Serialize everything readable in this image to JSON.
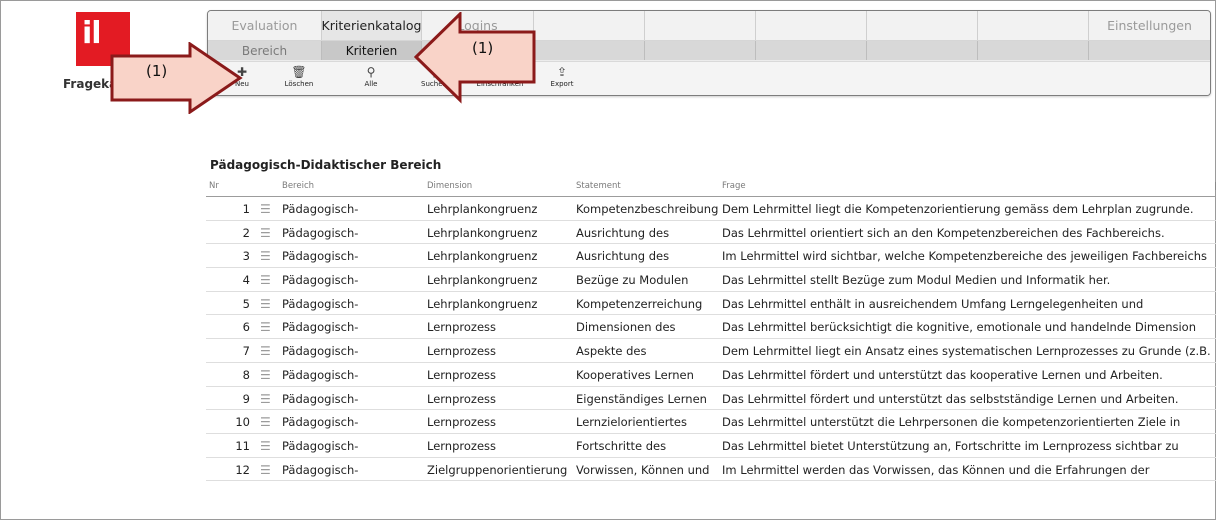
{
  "app": {
    "logo_text": "il",
    "name": "Fragekatalog"
  },
  "tabs_row1": [
    "Evaluation",
    "Kriterienkatalog",
    "Logins",
    "",
    "",
    "",
    "",
    "",
    "Einstellungen"
  ],
  "tabs_row2": [
    "Bereich",
    "Kriterien",
    "",
    "",
    "",
    "",
    "",
    "",
    ""
  ],
  "actions": [
    {
      "label": "Neu",
      "icon": "plus-icon",
      "glyph": "✚"
    },
    {
      "label": "Löschen",
      "icon": "trash-icon",
      "glyph": "🗑"
    },
    {
      "label": "Alle",
      "icon": "search-icon",
      "glyph": "⚲"
    },
    {
      "label": "Suchen",
      "icon": "search-icon",
      "glyph": "⚲"
    },
    {
      "label": "Einschränken",
      "icon": "search-icon",
      "glyph": "⚲"
    },
    {
      "label": "Export",
      "icon": "export-icon",
      "glyph": "⇪"
    }
  ],
  "callouts": {
    "left": "(1)",
    "right": "(1)",
    "arrow_fill": "#f9d3c8",
    "arrow_stroke": "#8b1a1a"
  },
  "section_title": "Pädagogisch-Didaktischer Bereich",
  "columns": {
    "nr": "Nr",
    "bereich": "Bereich",
    "dimension": "Dimension",
    "statement": "Statement",
    "frage": "Frage"
  },
  "rows": [
    {
      "nr": "1",
      "bereich": "Pädagogisch-",
      "dimension": "Lehrplankongruenz",
      "statement": "Kompetenzbeschreibung",
      "frage": "Dem Lehrmittel liegt die Kompetenzorientierung gemäss dem Lehrplan zugrunde."
    },
    {
      "nr": "2",
      "bereich": "Pädagogisch-",
      "dimension": "Lehrplankongruenz",
      "statement": "Ausrichtung des",
      "frage": "Das Lehrmittel orientiert sich an den Kompetenzbereichen des Fachbereichs."
    },
    {
      "nr": "3",
      "bereich": "Pädagogisch-",
      "dimension": "Lehrplankongruenz",
      "statement": "Ausrichtung des",
      "frage": "Im Lehrmittel wird sichtbar, welche Kompetenzbereiche des jeweiligen Fachbereichs"
    },
    {
      "nr": "4",
      "bereich": "Pädagogisch-",
      "dimension": "Lehrplankongruenz",
      "statement": "Bezüge zu Modulen",
      "frage": "Das Lehrmittel stellt Bezüge zum Modul Medien und Informatik her."
    },
    {
      "nr": "5",
      "bereich": "Pädagogisch-",
      "dimension": "Lehrplankongruenz",
      "statement": "Kompetenzerreichung",
      "frage": "Das Lehrmittel enthält in ausreichendem Umfang Lerngelegenheiten und"
    },
    {
      "nr": "6",
      "bereich": "Pädagogisch-",
      "dimension": "Lernprozess",
      "statement": "Dimensionen des",
      "frage": "Das Lehrmittel berücksichtigt die kognitive, emotionale und handelnde Dimension"
    },
    {
      "nr": "7",
      "bereich": "Pädagogisch-",
      "dimension": "Lernprozess",
      "statement": "Aspekte des",
      "frage": "Dem Lehrmittel liegt ein Ansatz eines systematischen Lernprozesses zu Grunde (z.B."
    },
    {
      "nr": "8",
      "bereich": "Pädagogisch-",
      "dimension": "Lernprozess",
      "statement": "Kooperatives Lernen",
      "frage": "Das Lehrmittel fördert und unterstützt das kooperative Lernen und Arbeiten."
    },
    {
      "nr": "9",
      "bereich": "Pädagogisch-",
      "dimension": "Lernprozess",
      "statement": "Eigenständiges Lernen",
      "frage": "Das Lehrmittel fördert und unterstützt das selbstständige Lernen und Arbeiten."
    },
    {
      "nr": "10",
      "bereich": "Pädagogisch-",
      "dimension": "Lernprozess",
      "statement": "Lernzielorientiertes",
      "frage": "Das Lehrmittel unterstützt die Lehrpersonen die kompetenzorientierten Ziele in"
    },
    {
      "nr": "11",
      "bereich": "Pädagogisch-",
      "dimension": "Lernprozess",
      "statement": "Fortschritte des",
      "frage": "Das Lehrmittel bietet Unterstützung an, Fortschritte im Lernprozess sichtbar zu"
    },
    {
      "nr": "12",
      "bereich": "Pädagogisch-",
      "dimension": "Zielgruppenorientierung",
      "statement": "Vorwissen, Können und",
      "frage": "Im Lehrmittel werden das Vorwissen, das Können und die Erfahrungen der"
    }
  ]
}
